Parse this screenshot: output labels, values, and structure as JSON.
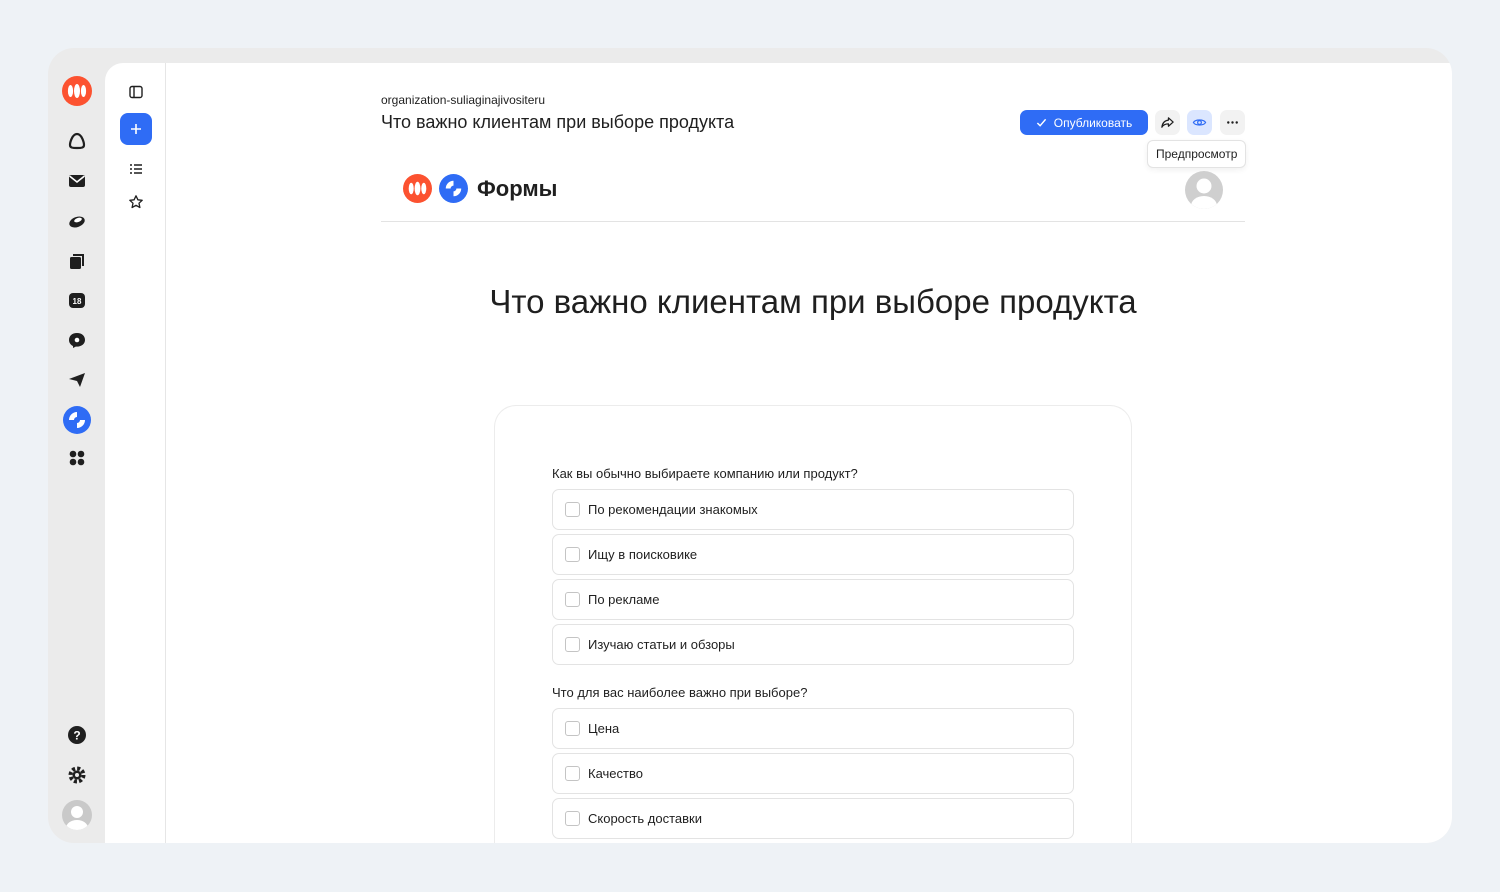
{
  "header": {
    "organization": "organization-suliaginajivositeru",
    "title": "Что важно клиентам при выборе продукта",
    "publish_label": "Опубликовать",
    "preview_tooltip": "Предпросмотр"
  },
  "brand": {
    "label": "Формы"
  },
  "form": {
    "title": "Что важно клиентам при выборе продукта",
    "questions": [
      {
        "label": "Как вы обычно выбираете компанию или продукт?",
        "options": [
          "По рекомендации знакомых",
          "Ищу в поисковике",
          "По рекламе",
          "Изучаю статьи и обзоры"
        ]
      },
      {
        "label": "Что для вас наиболее важно при выборе?",
        "options": [
          "Цена",
          "Качество",
          "Скорость доставки"
        ]
      }
    ]
  },
  "colors": {
    "accent": "#2f6cf5",
    "brand_orange": "#fc5230"
  }
}
